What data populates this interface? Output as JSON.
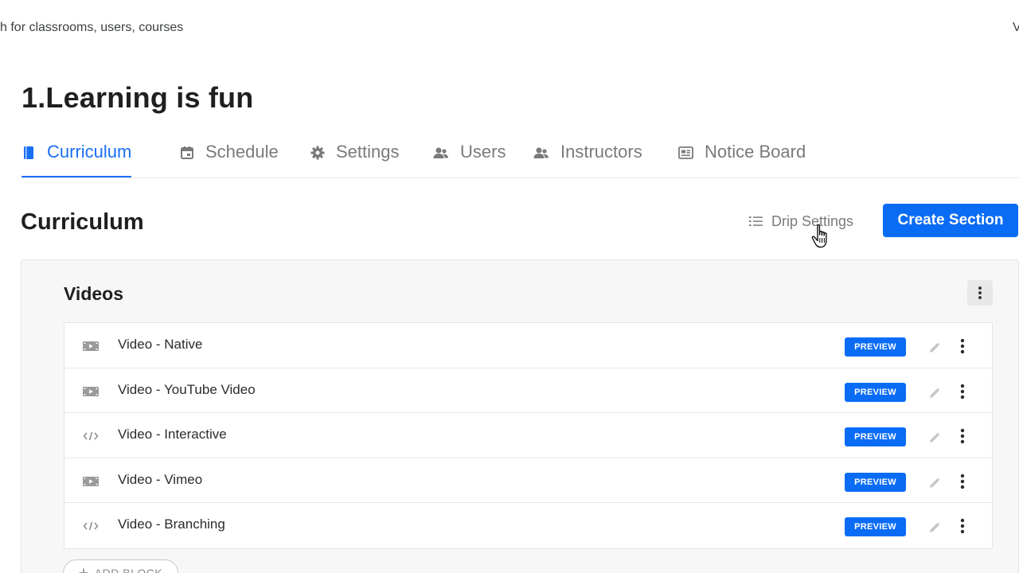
{
  "topbar": {
    "search_text": "h for classrooms, users, courses",
    "right_clipped_text": "V"
  },
  "page": {
    "title": "1.Learning is fun"
  },
  "tabs": [
    {
      "label": "Curriculum",
      "icon": "book-icon",
      "active": true
    },
    {
      "label": "Schedule",
      "icon": "calendar-icon",
      "active": false
    },
    {
      "label": "Settings",
      "icon": "gear-icon",
      "active": false
    },
    {
      "label": "Users",
      "icon": "users-icon",
      "active": false
    },
    {
      "label": "Instructors",
      "icon": "instructors-icon",
      "active": false
    },
    {
      "label": "Notice Board",
      "icon": "notice-board-icon",
      "active": false
    }
  ],
  "curriculum": {
    "heading": "Curriculum",
    "drip_settings_label": "Drip Settings",
    "create_section_label": "Create Section"
  },
  "section": {
    "title": "Videos",
    "add_block_label": "ADD BLOCK",
    "blocks": [
      {
        "title": "Video - Native",
        "icon": "video-icon",
        "badge": "PREVIEW"
      },
      {
        "title": "Video - YouTube Video",
        "icon": "video-icon",
        "badge": "PREVIEW"
      },
      {
        "title": "Video - Interactive",
        "icon": "code-icon",
        "badge": "PREVIEW"
      },
      {
        "title": "Video - Vimeo",
        "icon": "video-icon",
        "badge": "PREVIEW"
      },
      {
        "title": "Video - Branching",
        "icon": "code-icon",
        "badge": "PREVIEW"
      }
    ]
  },
  "colors": {
    "accent": "#0a6cf5",
    "tab_active": "#1a6ef5",
    "tab_inactive": "#7a7a7a",
    "card_background": "#f7f7f7"
  }
}
